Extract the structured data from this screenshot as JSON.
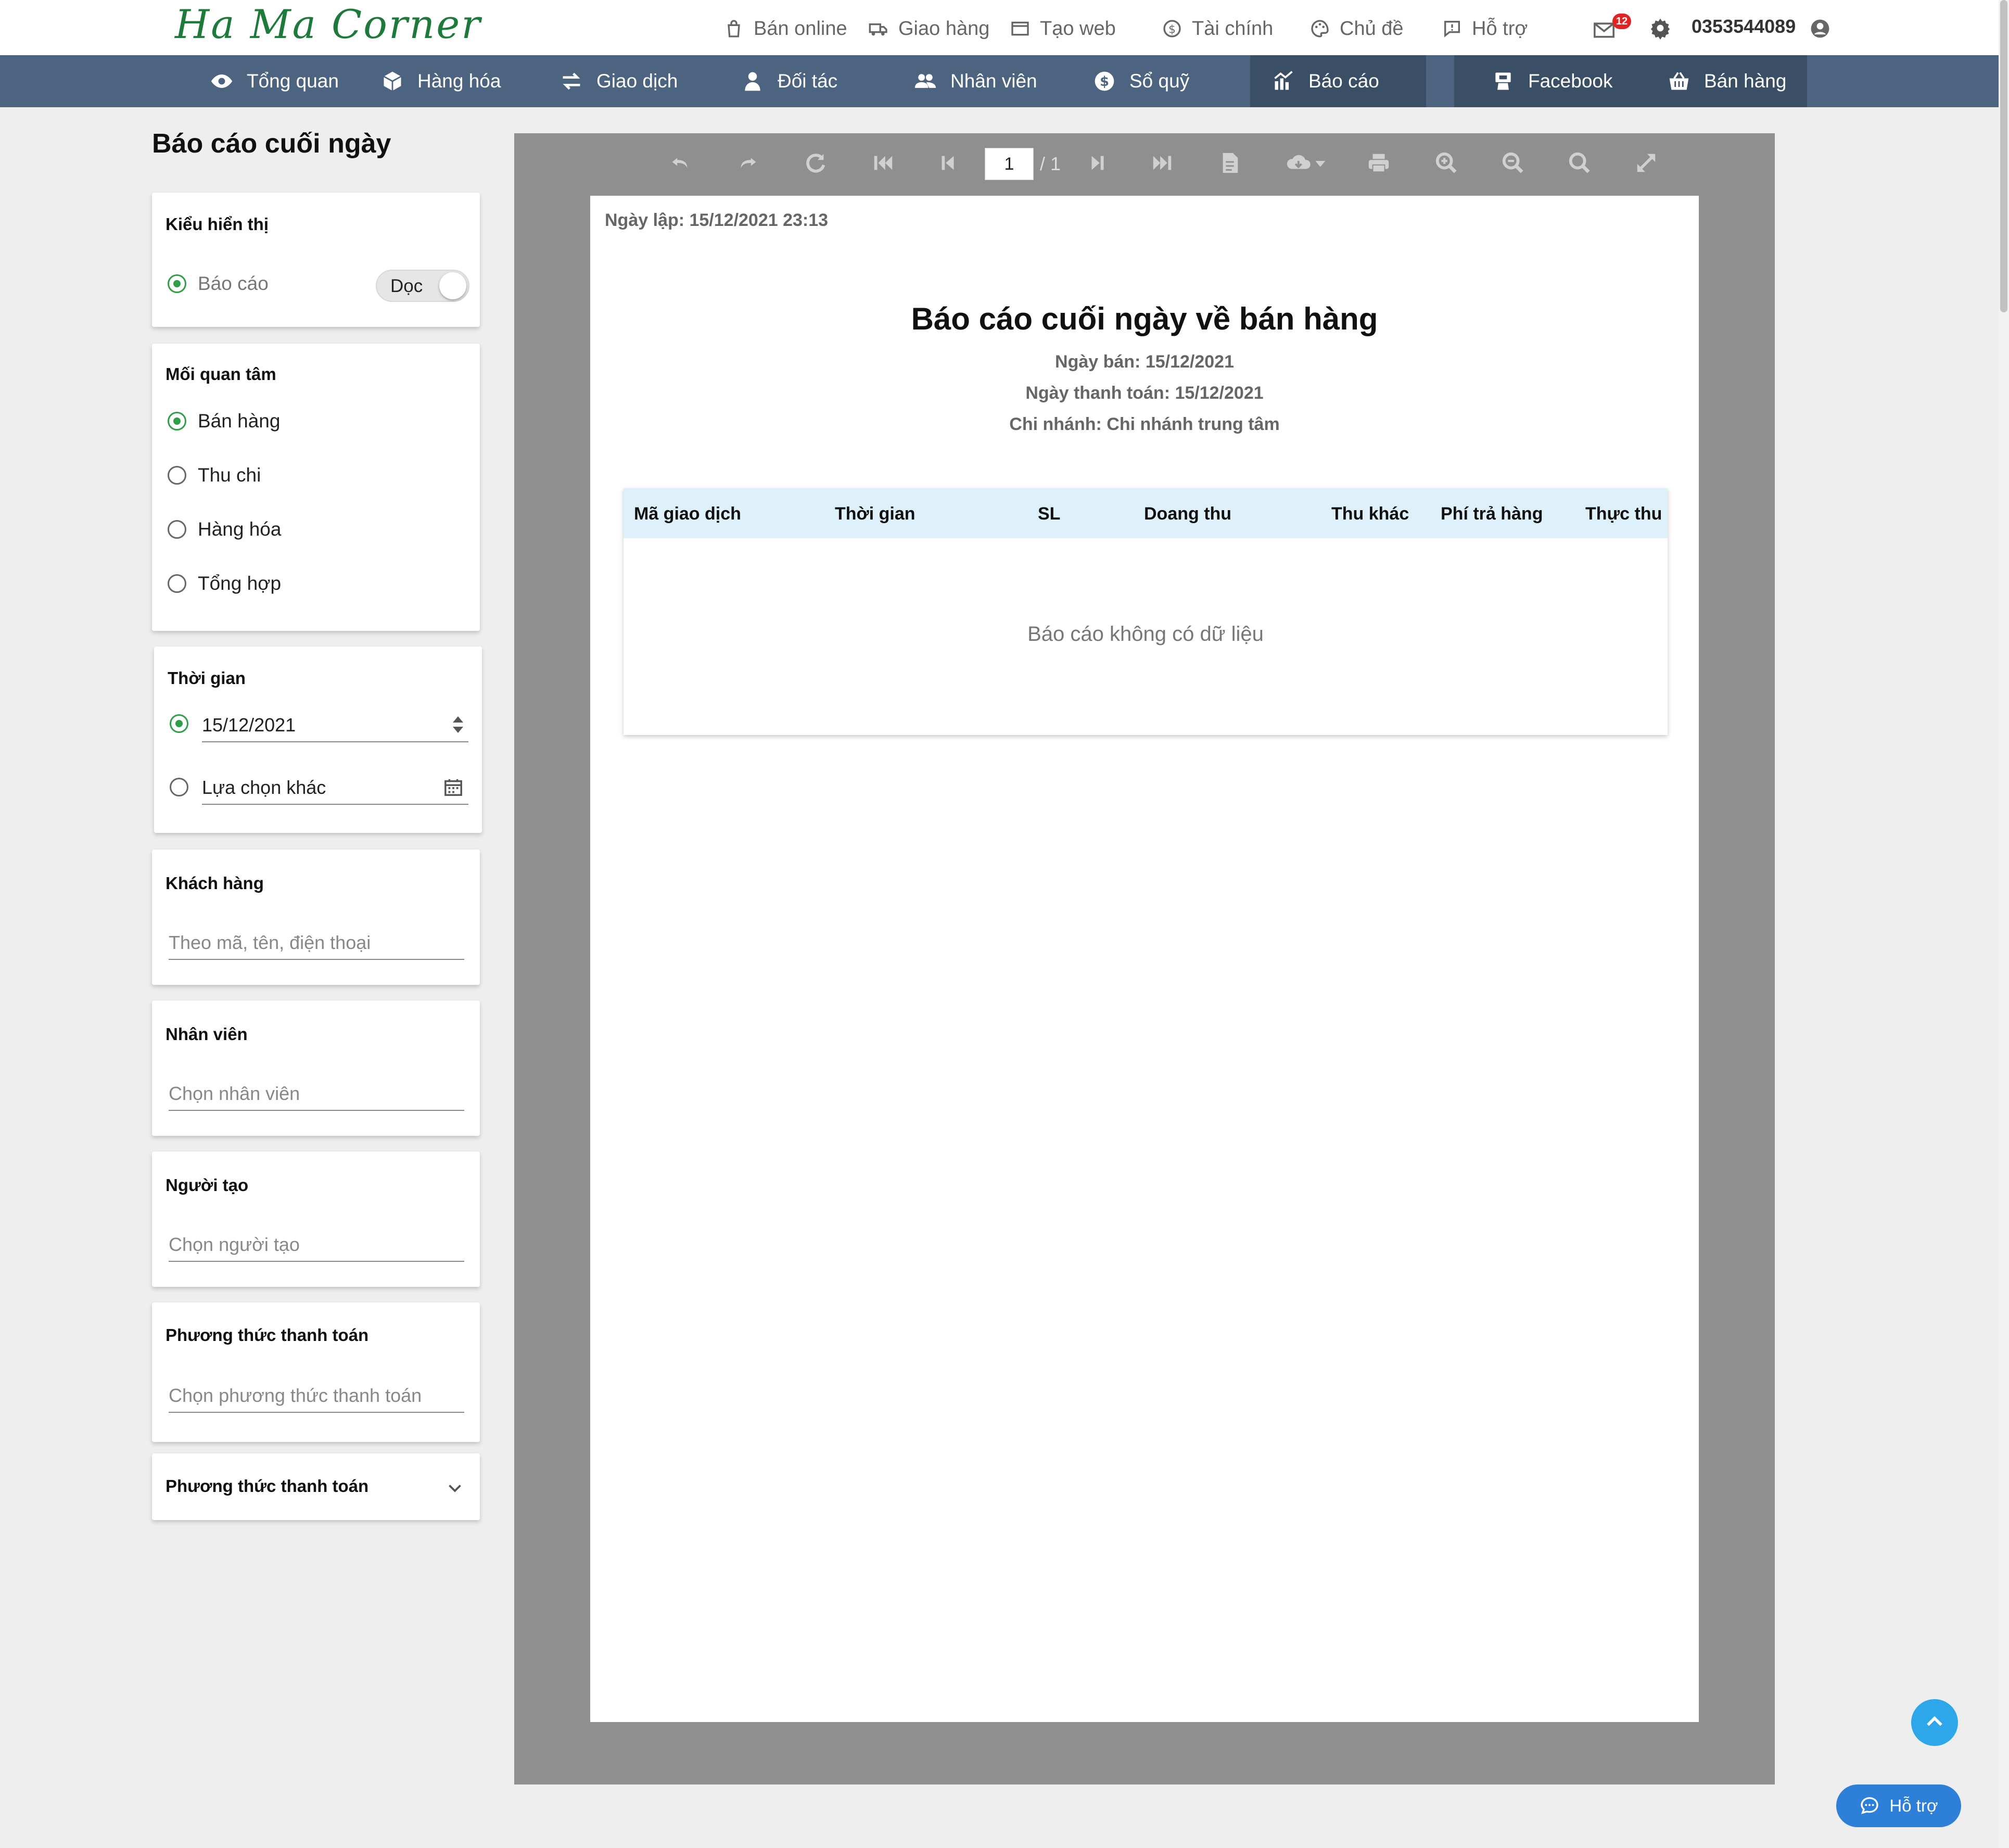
{
  "brand": {
    "logo_text": "Ha Ma Corner",
    "color": "#1e7a3a"
  },
  "topbar": {
    "links": [
      "Bán online",
      "Giao hàng",
      "Tạo web",
      "Tài chính",
      "Chủ đề",
      "Hỗ trợ"
    ],
    "mail_badge": "12",
    "phone": "0353544089"
  },
  "navbar": {
    "items": [
      "Tổng quan",
      "Hàng hóa",
      "Giao dịch",
      "Đối tác",
      "Nhân viên",
      "Sổ quỹ",
      "Báo cáo",
      "Facebook",
      "Bán hàng"
    ],
    "active": "Báo cáo",
    "bg_color": "#4d6480"
  },
  "page": {
    "title": "Báo cáo cuối ngày"
  },
  "filters": {
    "display": {
      "title": "Kiểu hiển thị",
      "option": "Báo cáo",
      "toggle_label": "Dọc"
    },
    "concern": {
      "title": "Mối quan tâm",
      "options": [
        "Bán hàng",
        "Thu chi",
        "Hàng hóa",
        "Tổng hợp"
      ],
      "selected": "Bán hàng"
    },
    "time": {
      "title": "Thời gian",
      "date_value": "15/12/2021",
      "other_label": "Lựa chọn khác"
    },
    "customer": {
      "title": "Khách hàng",
      "placeholder": "Theo mã, tên, điện thoại"
    },
    "employee": {
      "title": "Nhân viên",
      "placeholder": "Chọn nhân viên"
    },
    "creator": {
      "title": "Người tạo",
      "placeholder": "Chọn người tạo"
    },
    "payment": {
      "title": "Phương thức thanh toán",
      "placeholder": "Chọn phương thức thanh toán"
    },
    "payment2": {
      "title": "Phương thức thanh toán"
    }
  },
  "viewer": {
    "page_current": "1",
    "page_total": "/ 1"
  },
  "report": {
    "created": "Ngày lập: 15/12/2021 23:13",
    "title": "Báo cáo cuối ngày về bán hàng",
    "sale_date": "Ngày bán: 15/12/2021",
    "payment_date": "Ngày thanh toán: 15/12/2021",
    "branch": "Chi nhánh: Chi nhánh trung tâm",
    "columns": [
      "Mã giao dịch",
      "Thời gian",
      "SL",
      "Doang thu",
      "Thu khác",
      "Phí trả hàng",
      "Thực thu"
    ],
    "empty_message": "Báo cáo không có dữ liệu",
    "header_color": "#def1fb"
  },
  "floating": {
    "support_label": "Hỗ trợ"
  }
}
